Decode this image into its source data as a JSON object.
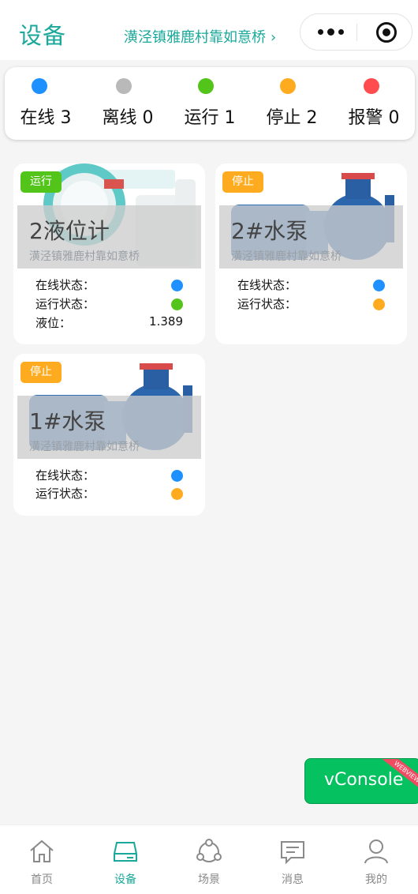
{
  "header": {
    "title": "设备",
    "location": "潢泾镇雅鹿村靠如意桥",
    "location_chevron": "›"
  },
  "summary": [
    {
      "label": "在线 3",
      "color": "#1e90ff"
    },
    {
      "label": "离线 0",
      "color": "#b9b9b9"
    },
    {
      "label": "运行 1",
      "color": "#52c41a"
    },
    {
      "label": "停止 2",
      "color": "#ffab1f"
    },
    {
      "label": "报警 0",
      "color": "#ff4d4f"
    }
  ],
  "devices": [
    {
      "name": "2液位计",
      "address": "潢泾镇雅鹿村靠如意桥",
      "status": "运行",
      "status_color": "#52c41a",
      "image_icon": "level-meter-image",
      "rows": [
        {
          "label": "在线状态：",
          "dot_color": "#1e90ff"
        },
        {
          "label": "运行状态：",
          "dot_color": "#52c41a"
        },
        {
          "label": "液位：",
          "value": "1.389"
        }
      ]
    },
    {
      "name": "2#水泵",
      "address": "潢泾镇雅鹿村靠如意桥",
      "status": "停止",
      "status_color": "#ffab1f",
      "image_icon": "water-pump-image",
      "rows": [
        {
          "label": "在线状态：",
          "dot_color": "#1e90ff"
        },
        {
          "label": "运行状态：",
          "dot_color": "#ffab1f"
        }
      ]
    },
    {
      "name": "1#水泵",
      "address": "潢泾镇雅鹿村靠如意桥",
      "status": "停止",
      "status_color": "#ffab1f",
      "image_icon": "water-pump-image",
      "rows": [
        {
          "label": "在线状态：",
          "dot_color": "#1e90ff"
        },
        {
          "label": "运行状态：",
          "dot_color": "#ffab1f"
        }
      ]
    }
  ],
  "vconsole": {
    "label": "vConsole",
    "ribbon": "WEBVIEW"
  },
  "tabbar": [
    {
      "label": "首页",
      "icon": "home-icon",
      "active": false
    },
    {
      "label": "设备",
      "icon": "device-icon",
      "active": true
    },
    {
      "label": "场景",
      "icon": "scene-icon",
      "active": false
    },
    {
      "label": "消息",
      "icon": "message-icon",
      "active": false
    },
    {
      "label": "我的",
      "icon": "profile-icon",
      "active": false
    }
  ],
  "colors": {
    "accent": "#1aa89a",
    "inactive": "#8a8a8a"
  }
}
